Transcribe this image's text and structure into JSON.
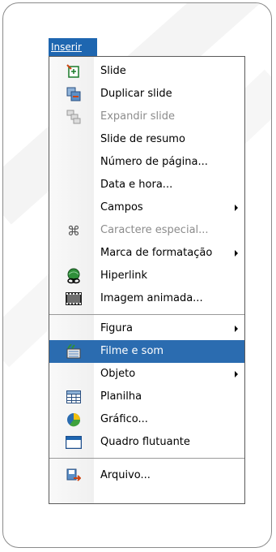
{
  "menu": {
    "title": "Inserir",
    "group1": [
      {
        "label": "Slide",
        "icon": "new-slide-icon"
      },
      {
        "label": "Duplicar slide",
        "icon": "duplicate-slide-icon"
      },
      {
        "label": "Expandir slide",
        "icon": "expand-slide-icon",
        "disabled": true
      },
      {
        "label": "Slide de resumo"
      },
      {
        "label": "Número de página..."
      },
      {
        "label": "Data e hora..."
      },
      {
        "label": "Campos",
        "submenu": true
      },
      {
        "label": "Caractere especial...",
        "icon": "special-character-icon",
        "disabled": true
      },
      {
        "label": "Marca de formatação",
        "submenu": true
      },
      {
        "label": "Hiperlink",
        "icon": "hyperlink-icon"
      },
      {
        "label": "Imagem animada...",
        "icon": "animated-image-icon"
      }
    ],
    "group2": [
      {
        "label": "Figura",
        "submenu": true
      },
      {
        "label": "Filme e som",
        "icon": "movie-sound-icon",
        "selected": true
      },
      {
        "label": "Objeto",
        "submenu": true
      },
      {
        "label": "Planilha",
        "icon": "spreadsheet-icon"
      },
      {
        "label": "Gráfico...",
        "icon": "chart-icon"
      },
      {
        "label": "Quadro flutuante",
        "icon": "floating-frame-icon"
      }
    ],
    "group3": [
      {
        "label": "Arquivo...",
        "icon": "file-insert-icon"
      }
    ]
  },
  "colors": {
    "highlight": "#2b6cb0",
    "title_bar": "#1e66b0",
    "disabled_text": "#8c8c8c"
  }
}
